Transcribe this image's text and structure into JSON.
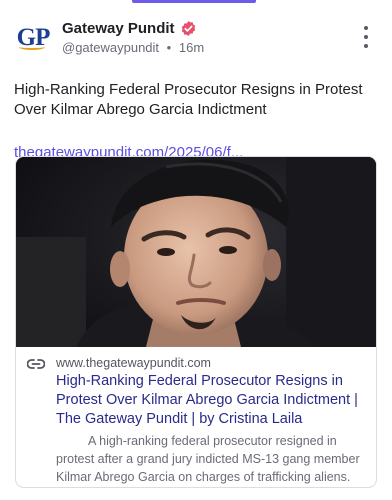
{
  "account": {
    "display_name": "Gateway Pundit",
    "handle": "@gatewaypundit",
    "separator": "•",
    "time": "16m",
    "avatar_initials": "GP",
    "verified_icon": "verified-badge-icon",
    "avatar_colors": {
      "letters": "#1c3f94",
      "swoosh": "#e3a21a"
    },
    "badge_color": "#e4506e"
  },
  "post": {
    "text": "High-Ranking Federal Prosecutor Resigns in Protest Over Kilmar Abrego Garcia Indictment",
    "link_text": "thegatewaypundit.com/2025/06/f..."
  },
  "card": {
    "domain": "www.thegatewaypundit.com",
    "title": "High-Ranking Federal Prosecutor Resigns in Protest Over Kilmar Abrego Garcia Indictment | The Gateway Pundit | by Cristina Laila",
    "description": "A high-ranking federal prosecutor resigned in protest after a grand jury indicted MS-13 gang member Kilmar Abrego Garcia on charges of trafficking aliens.",
    "link_icon": "link-icon",
    "image_icon": "person-photo"
  },
  "colors": {
    "accent": "#6c5ce7",
    "link": "#5b4fe0",
    "card_title": "#2a2a8a",
    "muted": "#6b6b78"
  }
}
